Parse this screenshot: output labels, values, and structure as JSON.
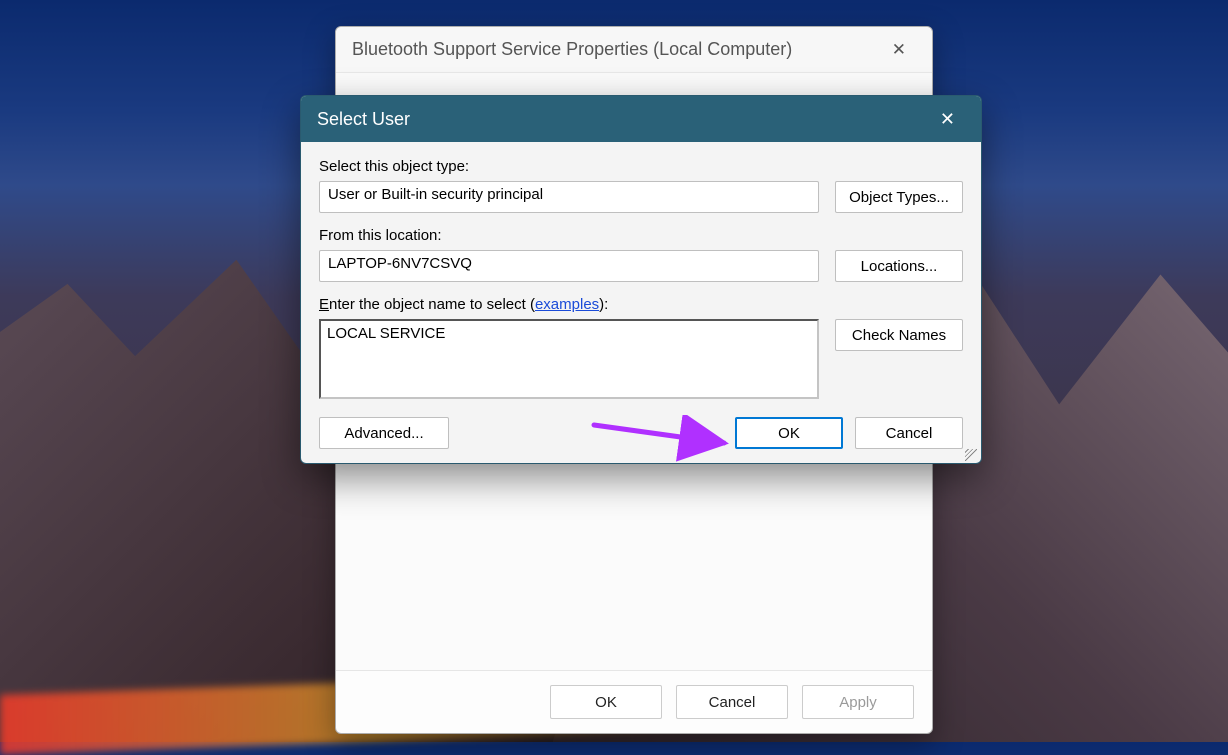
{
  "parent": {
    "title": "Bluetooth Support Service Properties (Local Computer)",
    "buttons": {
      "ok": "OK",
      "cancel": "Cancel",
      "apply": "Apply"
    }
  },
  "dialog": {
    "title": "Select User",
    "labels": {
      "object_type": "Select this object type:",
      "from_location": "From this location:",
      "enter_prefix": "E",
      "enter_rest": "nter the object name to select (",
      "examples": "examples",
      "enter_suffix": "):"
    },
    "values": {
      "object_type": "User or Built-in security principal",
      "from_location": "LAPTOP-6NV7CSVQ",
      "object_name": "LOCAL SERVICE"
    },
    "buttons": {
      "object_types": "Object Types...",
      "locations": "Locations...",
      "check_names": "Check Names",
      "advanced": "Advanced...",
      "ok": "OK",
      "cancel": "Cancel"
    }
  }
}
